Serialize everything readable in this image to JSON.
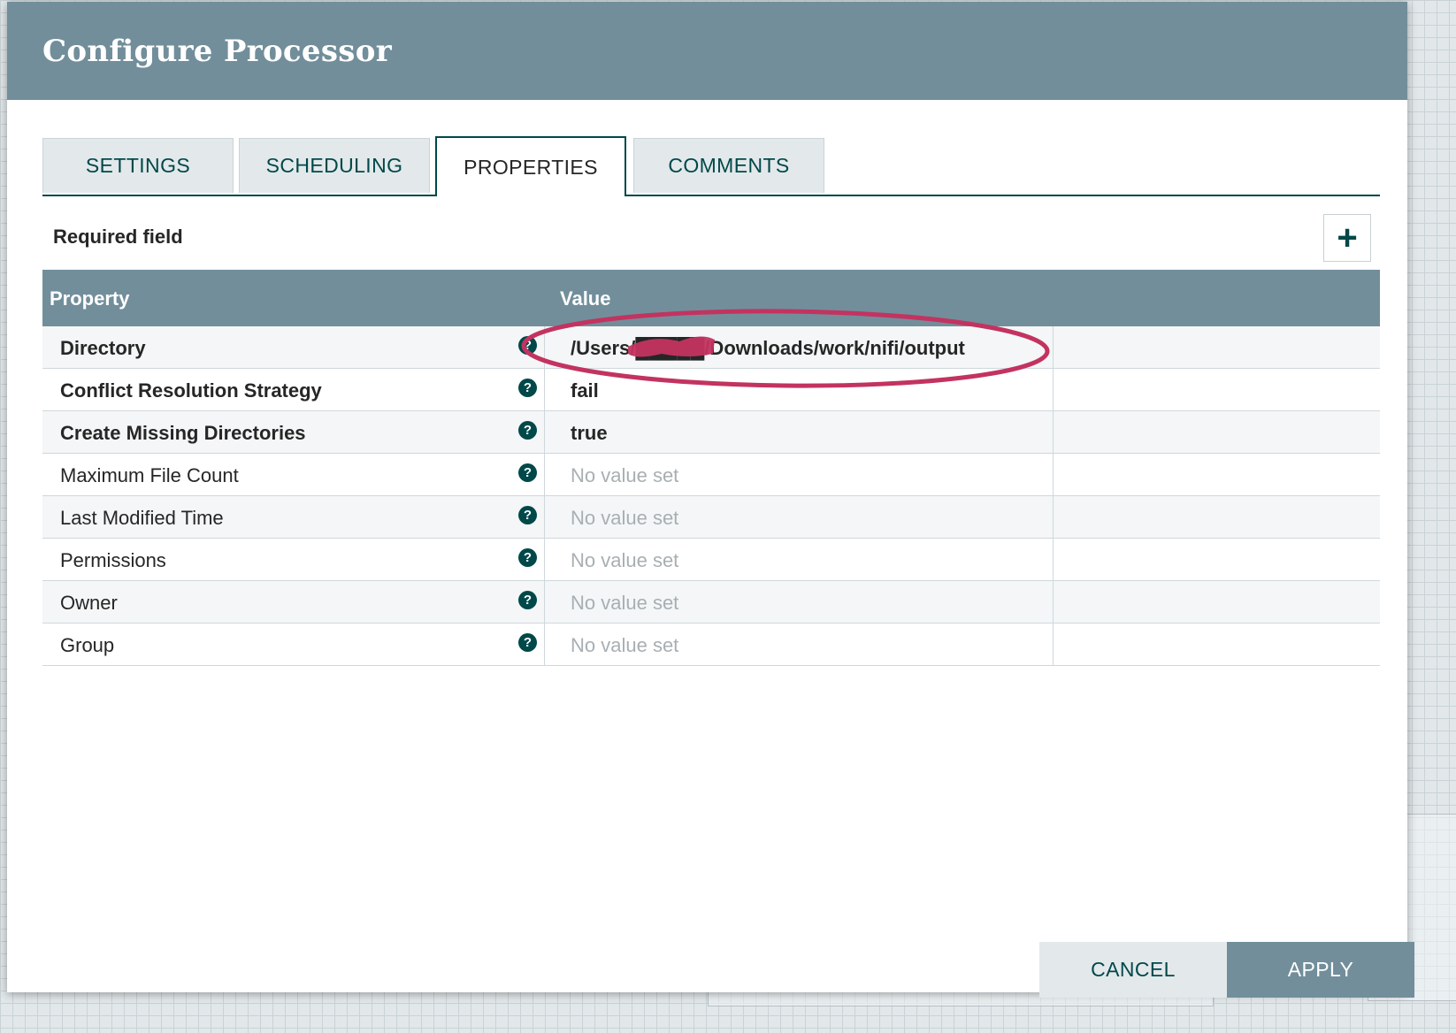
{
  "dialog": {
    "title": "Configure Processor"
  },
  "tabs": [
    {
      "label": "SETTINGS",
      "active": false
    },
    {
      "label": "SCHEDULING",
      "active": false
    },
    {
      "label": "PROPERTIES",
      "active": true
    },
    {
      "label": "COMMENTS",
      "active": false
    }
  ],
  "properties_panel": {
    "required_label": "Required field",
    "add_icon": "plus-icon",
    "columns": {
      "property": "Property",
      "value": "Value"
    },
    "rows": [
      {
        "name": "Directory",
        "value": "/Users/█████/Downloads/work/nifi/output",
        "required": true,
        "set": true
      },
      {
        "name": "Conflict Resolution Strategy",
        "value": "fail",
        "required": true,
        "set": true
      },
      {
        "name": "Create Missing Directories",
        "value": "true",
        "required": true,
        "set": true
      },
      {
        "name": "Maximum File Count",
        "value": "No value set",
        "required": false,
        "set": false
      },
      {
        "name": "Last Modified Time",
        "value": "No value set",
        "required": false,
        "set": false
      },
      {
        "name": "Permissions",
        "value": "No value set",
        "required": false,
        "set": false
      },
      {
        "name": "Owner",
        "value": "No value set",
        "required": false,
        "set": false
      },
      {
        "name": "Group",
        "value": "No value set",
        "required": false,
        "set": false
      }
    ],
    "help_icon": "question-circle-icon"
  },
  "footer": {
    "cancel_label": "CANCEL",
    "apply_label": "APPLY"
  },
  "colors": {
    "header": "#728e9b",
    "accent": "#004849",
    "annotation": "#c33360"
  }
}
